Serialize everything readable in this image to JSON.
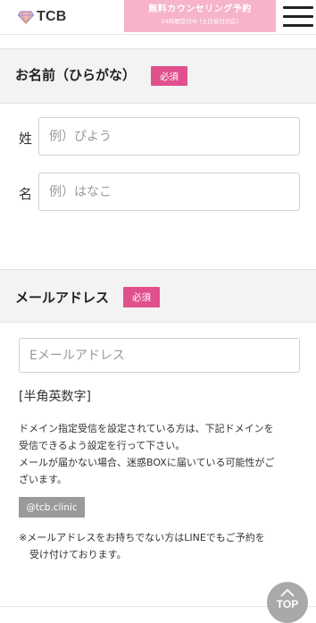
{
  "header": {
    "logo_text": "TCB",
    "cta_main": "無料カウンセリング予約",
    "cta_sub": "24時間受付中 (土日祝日対応)",
    "menu_icon": "hamburger-icon"
  },
  "name_section": {
    "title": "お名前（ひらがな）",
    "badge": "必須",
    "last_label": "姓",
    "last_placeholder": "例）ぴよう",
    "last_value": "",
    "first_label": "名",
    "first_placeholder": "例）はなこ",
    "first_value": ""
  },
  "email_section": {
    "title": "メールアドレス",
    "badge": "必須",
    "email_placeholder": "Eメールアドレス",
    "email_value": "",
    "hint": "[半角英数字]",
    "note_lines": [
      "ドメイン指定受信を設定されている方は、下記ドメインを",
      "受信できるよう設定を行って下さい。",
      "メールが届かない場合、迷惑BOXに届いている可能性がご",
      "ざいます。"
    ],
    "domain": "@tcb.clinic",
    "line_note_1": "※メールアドレスをお持ちでない方はLINEでもご予約を",
    "line_note_2": "受け付けております。"
  },
  "top_button": {
    "label": "TOP",
    "icon": "chevron-up-icon"
  },
  "colors": {
    "cta_bg": "#f6b3ca",
    "badge": "#e0508d",
    "section_bg": "#f3f3f3",
    "domain_tag_bg": "#9a9a9a",
    "top_button_bg": "#a9a9a9"
  }
}
